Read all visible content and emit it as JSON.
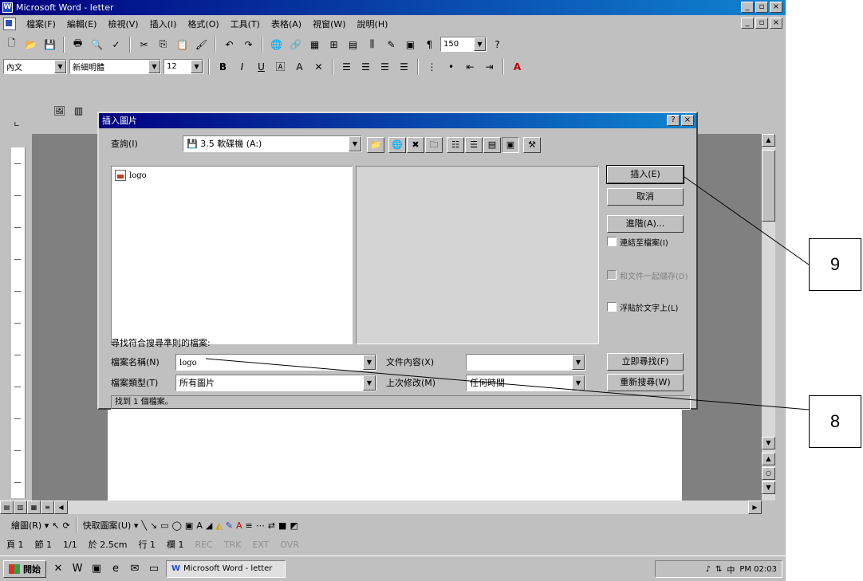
{
  "window": {
    "title": "Microsoft Word - letter",
    "buttons": {
      "minimize": "_",
      "maximize": "▫",
      "close": "×"
    }
  },
  "menubar": {
    "items": [
      "檔案(F)",
      "編輯(E)",
      "檢視(V)",
      "插入(I)",
      "格式(O)",
      "工具(T)",
      "表格(A)",
      "視窗(W)",
      "說明(H)"
    ]
  },
  "toolbar_standard": {
    "zoom_value": "150"
  },
  "toolbar_format": {
    "style_value": "內文",
    "font_value": "新細明體",
    "size_value": "12"
  },
  "dialog": {
    "title": "插入圖片",
    "look_in_label": "查詢(I)",
    "look_in_value": "3.5 軟碟機 (A:)",
    "file_item": "logo",
    "buttons": {
      "insert": "插入(E)",
      "cancel": "取消",
      "advanced": "進階(A)..."
    },
    "checkboxes": {
      "link_to_file": "連結至檔案(I)",
      "save_with_doc": "和文件一起儲存(D)",
      "float_over_text": "浮貼於文字上(L)"
    },
    "search_heading": "尋找符合搜尋準則的檔案:",
    "file_name_label": "檔案名稱(N)",
    "file_name_value": "logo",
    "file_type_label": "檔案類型(T)",
    "file_type_value": "所有圖片",
    "text_label": "文件內容(X)",
    "text_value": "",
    "modified_label": "上次修改(M)",
    "modified_value": "任何時間",
    "find_now": "立即尋找(F)",
    "new_search": "重新搜尋(W)",
    "status": "找到 1 個檔案。"
  },
  "drawbar": {
    "draw_label": "繪圖(R) ▾",
    "autoshapes_label": "快取圖案(U) ▾"
  },
  "statusbar": {
    "page": "頁 1",
    "section": "節 1",
    "pages": "1/1",
    "at": "於 2.5cm",
    "line": "行 1",
    "col": "欄 1",
    "rec": "REC",
    "trk": "TRK",
    "ext": "EXT",
    "ovr": "OVR"
  },
  "taskbar": {
    "start": "開始",
    "task": "Microsoft Word - letter",
    "clock": "PM 02:03"
  },
  "callouts": {
    "first": "9",
    "second": "8"
  }
}
